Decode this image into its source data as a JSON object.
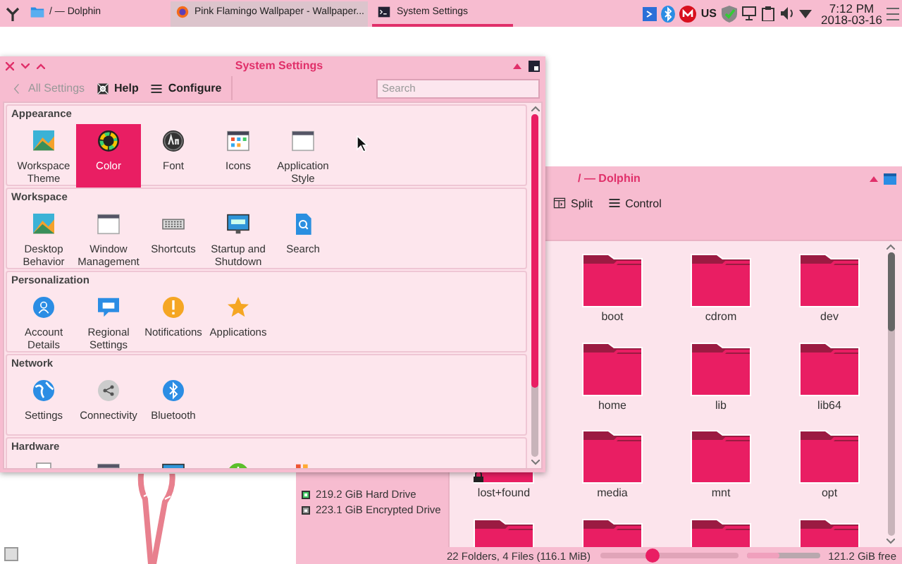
{
  "panel": {
    "tasks": [
      {
        "title": "/ — Dolphin",
        "kind": "folder",
        "selected": false,
        "hovered": false
      },
      {
        "title": "Pink Flamingo Wallpaper - Wallpaper...",
        "kind": "browser",
        "selected": false,
        "hovered": true
      },
      {
        "title": "System Settings",
        "kind": "settings",
        "selected": true,
        "hovered": false
      }
    ],
    "keyboard_layout": "US",
    "clock": {
      "time": "7:12 PM",
      "date": "2018-03-16"
    }
  },
  "settings": {
    "title": "System Settings",
    "toolbar": [
      {
        "label": "All Settings",
        "kind": "back",
        "disabled": true
      },
      {
        "label": "Help",
        "kind": "help",
        "disabled": false
      },
      {
        "label": "Configure",
        "kind": "menu",
        "disabled": false
      }
    ],
    "search": {
      "placeholder": "Search"
    },
    "sections": [
      {
        "title": "Appearance",
        "items": [
          {
            "label": "Workspace Theme",
            "kind": "theme",
            "selected": false
          },
          {
            "label": "Color",
            "kind": "color",
            "selected": true
          },
          {
            "label": "Font",
            "kind": "font",
            "selected": false
          },
          {
            "label": "Icons",
            "kind": "grid",
            "selected": false
          },
          {
            "label": "Application Style",
            "kind": "window",
            "selected": false
          }
        ]
      },
      {
        "title": "Workspace",
        "items": [
          {
            "label": "Desktop Behavior",
            "kind": "theme",
            "selected": false
          },
          {
            "label": "Window Management",
            "kind": "window",
            "selected": false
          },
          {
            "label": "Shortcuts",
            "kind": "keyboard",
            "selected": false
          },
          {
            "label": "Startup and Shutdown",
            "kind": "monitor",
            "selected": false
          },
          {
            "label": "Search",
            "kind": "searchdoc",
            "selected": false
          }
        ]
      },
      {
        "title": "Personalization",
        "items": [
          {
            "label": "Account Details",
            "kind": "user",
            "selected": false
          },
          {
            "label": "Regional Settings",
            "kind": "bubble",
            "selected": false
          },
          {
            "label": "Notifications",
            "kind": "warning",
            "selected": false
          },
          {
            "label": "Applications",
            "kind": "star",
            "selected": false
          }
        ]
      },
      {
        "title": "Network",
        "items": [
          {
            "label": "Settings",
            "kind": "globe",
            "selected": false
          },
          {
            "label": "Connectivity",
            "kind": "share",
            "selected": false
          },
          {
            "label": "Bluetooth",
            "kind": "bluetooth",
            "selected": false
          }
        ]
      },
      {
        "title": "Hardware",
        "items": [
          {
            "kind": "printer"
          },
          {
            "kind": "window"
          },
          {
            "kind": "monitor"
          },
          {
            "kind": "power"
          },
          {
            "kind": "devices"
          }
        ]
      }
    ]
  },
  "dolphin": {
    "title": "/ — Dolphin",
    "toolbar": [
      {
        "label": "Split",
        "kind": "split"
      },
      {
        "label": "Control",
        "kind": "menu"
      }
    ],
    "places": [
      {
        "label": "219.2 GiB Hard Drive",
        "kind": "drive"
      },
      {
        "label": "223.1 GiB Encrypted Drive",
        "kind": "encrypted"
      }
    ],
    "rows": [
      {
        "folders": [
          {
            "name": "boot",
            "kind": "folder"
          },
          {
            "name": "cdrom",
            "kind": "folder"
          },
          {
            "name": "dev",
            "kind": "folder"
          }
        ]
      },
      {
        "folders": [
          {
            "name": "home",
            "kind": "folder"
          },
          {
            "name": "lib",
            "kind": "folder"
          },
          {
            "name": "lib64",
            "kind": "folder"
          }
        ]
      },
      {
        "folders": [
          {
            "name": "lost+found",
            "kind": "locked"
          },
          {
            "name": "media",
            "kind": "folder"
          },
          {
            "name": "mnt",
            "kind": "folder"
          },
          {
            "name": "opt",
            "kind": "folder"
          }
        ]
      },
      {
        "folders": [
          {
            "kind": "folder"
          },
          {
            "kind": "folder"
          },
          {
            "kind": "folder"
          },
          {
            "kind": "folder"
          }
        ]
      }
    ],
    "status": {
      "summary": "22 Folders, 4 Files (116.1 MiB)",
      "zoom": {
        "level": 0.38
      },
      "space": {
        "level": 0.45,
        "reading": "121.2 GiB free"
      }
    }
  }
}
